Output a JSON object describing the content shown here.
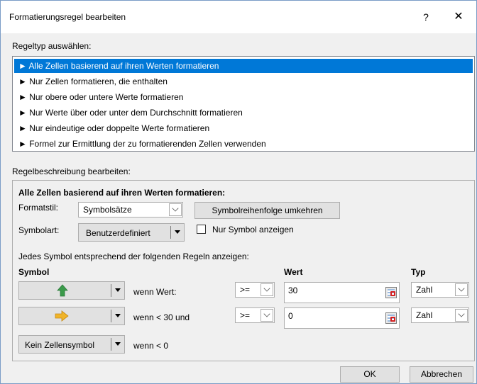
{
  "window": {
    "title": "Formatierungsregel bearbeiten",
    "help": "?",
    "close": "✕"
  },
  "rule_type": {
    "label": "Regeltyp auswählen:",
    "items": [
      "► Alle Zellen basierend auf ihren Werten formatieren",
      "► Nur Zellen formatieren, die enthalten",
      "► Nur obere oder untere Werte formatieren",
      "► Nur Werte über oder unter dem Durchschnitt formatieren",
      "► Nur eindeutige oder doppelte Werte formatieren",
      "► Formel zur Ermittlung der zu formatierenden Zellen verwenden"
    ],
    "selected_index": 0
  },
  "description": {
    "label": "Regelbeschreibung bearbeiten:",
    "heading": "Alle Zellen basierend auf ihren Werten formatieren:",
    "format_style_label": "Formatstil:",
    "format_style_value": "Symbolsätze",
    "reverse_order_button": "Symbolreihenfolge umkehren",
    "icon_style_label": "Symbolart:",
    "icon_style_value": "Benutzerdefiniert",
    "show_icon_only_label": "Nur Symbol anzeigen",
    "show_icon_only_checked": false,
    "rules_intro": "Jedes Symbol entsprechend der folgenden Regeln anzeigen:",
    "col_symbol": "Symbol",
    "col_value": "Wert",
    "col_type": "Typ",
    "rows": [
      {
        "icon": "green-up-arrow-icon",
        "icon_color": "#3a9a4a",
        "condition": "wenn Wert:",
        "operator": ">=",
        "value": "30",
        "type": "Zahl"
      },
      {
        "icon": "yellow-right-arrow-icon",
        "icon_color": "#f0b429",
        "condition": "wenn < 30 und",
        "operator": ">=",
        "value": "0",
        "type": "Zahl"
      },
      {
        "icon_text": "Kein Zellensymbol",
        "condition": "wenn < 0"
      }
    ]
  },
  "buttons": {
    "ok": "OK",
    "cancel": "Abbrechen"
  },
  "colors": {
    "selection": "#0078d7",
    "dialog_bg": "#f0f0f0"
  }
}
